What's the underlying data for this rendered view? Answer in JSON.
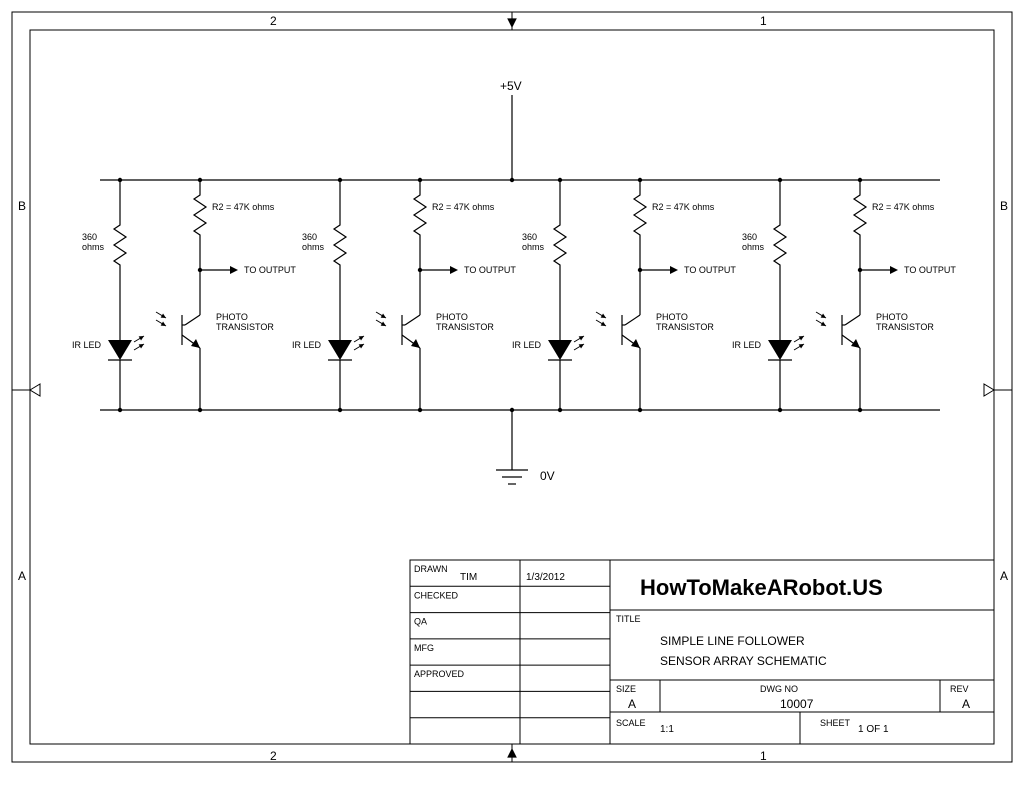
{
  "power": {
    "pos": "+5V",
    "neg": "0V"
  },
  "stage": {
    "r_led": "360\nohms",
    "r_photo": "R2 = 47K ohms",
    "led": "IR LED",
    "photo": "PHOTO\nTRANSISTOR",
    "out": "TO OUTPUT"
  },
  "border": {
    "cols": [
      "2",
      "1"
    ],
    "rows": [
      "B",
      "A"
    ]
  },
  "title_block": {
    "rows": [
      {
        "k": "DRAWN",
        "v1": "TIM",
        "v2": "1/3/2012"
      },
      {
        "k": "CHECKED",
        "v1": "",
        "v2": ""
      },
      {
        "k": "QA",
        "v1": "",
        "v2": ""
      },
      {
        "k": "MFG",
        "v1": "",
        "v2": ""
      },
      {
        "k": "APPROVED",
        "v1": "",
        "v2": ""
      }
    ],
    "company": "HowToMakeARobot.US",
    "title_label": "TITLE",
    "title1": "SIMPLE LINE FOLLOWER",
    "title2": "SENSOR ARRAY SCHEMATIC",
    "size_label": "SIZE",
    "size": "A",
    "dwg_label": "DWG NO",
    "dwg": "10007",
    "rev_label": "REV",
    "rev": "A",
    "scale_label": "SCALE",
    "scale": "1:1",
    "sheet_label": "SHEET",
    "sheet": "1 OF 1"
  }
}
